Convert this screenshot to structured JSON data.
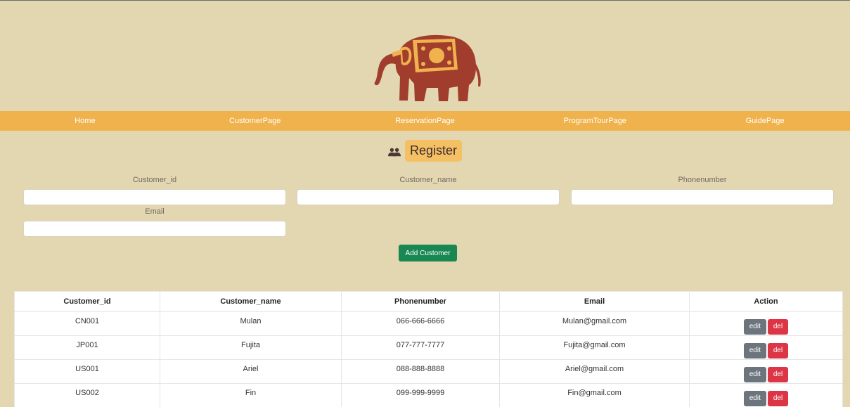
{
  "nav": {
    "items": [
      "Home",
      "CustomerPage",
      "ReservationPage",
      "ProgramTourPage",
      "GuidePage"
    ]
  },
  "register": {
    "title": "Register",
    "icon": "users-icon"
  },
  "form": {
    "customer_id_label": "Customer_id",
    "customer_name_label": "Customer_name",
    "phonenumber_label": "Phonenumber",
    "email_label": "Email",
    "customer_id_value": "",
    "customer_name_value": "",
    "phonenumber_value": "",
    "email_value": "",
    "add_button": "Add Customer"
  },
  "table": {
    "headers": [
      "Customer_id",
      "Customer_name",
      "Phonenumber",
      "Email",
      "Action"
    ],
    "rows": [
      {
        "id": "CN001",
        "name": "Mulan",
        "phone": "066-666-6666",
        "email": "Mulan@gmail.com"
      },
      {
        "id": "JP001",
        "name": "Fujita",
        "phone": "077-777-7777",
        "email": "Fujita@gmail.com"
      },
      {
        "id": "US001",
        "name": "Ariel",
        "phone": "088-888-8888",
        "email": "Ariel@gmail.com"
      },
      {
        "id": "US002",
        "name": "Fin",
        "phone": "099-999-9999",
        "email": "Fin@gmail.com"
      }
    ],
    "edit_label": "edit",
    "del_label": "del"
  },
  "colors": {
    "background": "#e3d7b1",
    "navbar": "#f0b24c",
    "elephant": "#a13d2d",
    "elephant_ornament": "#f0b24c",
    "add_button": "#198754",
    "edit_button": "#6c757d",
    "del_button": "#dc3545"
  },
  "logo": {
    "icon": "elephant-icon"
  }
}
